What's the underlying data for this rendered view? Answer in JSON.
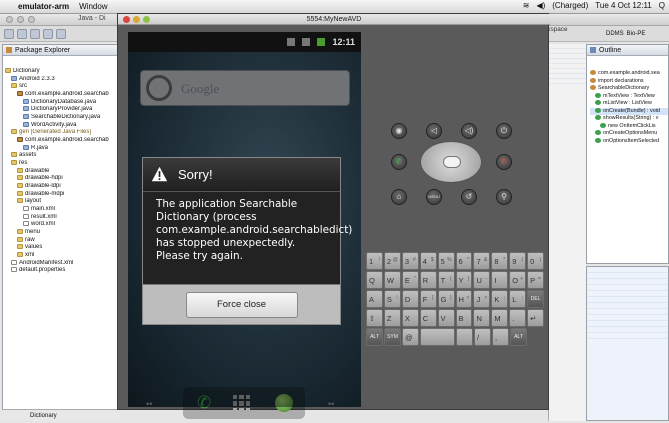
{
  "menubar": {
    "app_name": "emulator-arm",
    "menus": [
      "Window"
    ],
    "status": {
      "charge": "(Charged)",
      "clock": "Tue 4 Oct  12:11"
    }
  },
  "eclipse": {
    "window_title": "Java - Di",
    "workspace_path": "x/workspace",
    "perspectives": [
      "DDMS",
      "Bio-PE"
    ],
    "package_explorer": {
      "title": "Package Explorer",
      "tree": [
        {
          "label": "Dictionary",
          "indent": 0,
          "icon": "project"
        },
        {
          "label": "Android 2.3.3",
          "indent": 1,
          "icon": "library"
        },
        {
          "label": "src",
          "indent": 1,
          "icon": "folder"
        },
        {
          "label": "com.example.android.searchab",
          "indent": 2,
          "icon": "package"
        },
        {
          "label": "DictionaryDatabase.java",
          "indent": 3,
          "icon": "java"
        },
        {
          "label": "DictionaryProvider.java",
          "indent": 3,
          "icon": "java"
        },
        {
          "label": "SearchableDictionary.java",
          "indent": 3,
          "icon": "java"
        },
        {
          "label": "WordActivity.java",
          "indent": 3,
          "icon": "java"
        },
        {
          "label": "gen [Generated Java Files]",
          "indent": 1,
          "icon": "folder",
          "style": "gen"
        },
        {
          "label": "com.example.android.searchab",
          "indent": 2,
          "icon": "package"
        },
        {
          "label": "R.java",
          "indent": 3,
          "icon": "java"
        },
        {
          "label": "assets",
          "indent": 1,
          "icon": "folder"
        },
        {
          "label": "res",
          "indent": 1,
          "icon": "folder"
        },
        {
          "label": "drawable",
          "indent": 2,
          "icon": "folder"
        },
        {
          "label": "drawable-hdpi",
          "indent": 2,
          "icon": "folder"
        },
        {
          "label": "drawable-ldpi",
          "indent": 2,
          "icon": "folder"
        },
        {
          "label": "drawable-mdpi",
          "indent": 2,
          "icon": "folder"
        },
        {
          "label": "layout",
          "indent": 2,
          "icon": "folder"
        },
        {
          "label": "main.xml",
          "indent": 3,
          "icon": "xml"
        },
        {
          "label": "result.xml",
          "indent": 3,
          "icon": "xml"
        },
        {
          "label": "word.xml",
          "indent": 3,
          "icon": "xml"
        },
        {
          "label": "menu",
          "indent": 2,
          "icon": "folder"
        },
        {
          "label": "raw",
          "indent": 2,
          "icon": "folder"
        },
        {
          "label": "values",
          "indent": 2,
          "icon": "folder"
        },
        {
          "label": "xml",
          "indent": 2,
          "icon": "folder"
        },
        {
          "label": "AndroidManifest.xml",
          "indent": 1,
          "icon": "xml"
        },
        {
          "label": "default.properties",
          "indent": 1,
          "icon": "file"
        }
      ]
    },
    "status_bar_text": "Dictionary",
    "outline": {
      "title": "Outline",
      "tree": [
        {
          "label": "com.example.android.sea",
          "indent": 0
        },
        {
          "label": "import declarations",
          "indent": 0
        },
        {
          "label": "SearchableDictionary",
          "indent": 0
        },
        {
          "label": "mTextView : TextView",
          "indent": 1
        },
        {
          "label": "mListView : ListView",
          "indent": 1
        },
        {
          "label": "onCreate(Bundle) : void",
          "indent": 1,
          "selected": true
        },
        {
          "label": "showResults(String) : v",
          "indent": 1
        },
        {
          "label": "new OnItemClickLis",
          "indent": 2
        },
        {
          "label": "onCreateOptionsMenu",
          "indent": 1
        },
        {
          "label": "onOptionsItemSelected",
          "indent": 1
        }
      ]
    }
  },
  "emulator": {
    "title": "5554:MyNewAVD",
    "clock": "12:11",
    "search_placeholder": "Google",
    "dialog": {
      "title": "Sorry!",
      "message": "The application Searchable Dictionary (process com.example.android.searchabledict) has stopped unexpectedly. Please try again.",
      "button": "Force close"
    },
    "keyboard": {
      "row1": [
        [
          "1",
          "!"
        ],
        [
          "2",
          "@"
        ],
        [
          "3",
          "#"
        ],
        [
          "4",
          "$"
        ],
        [
          "5",
          "%"
        ],
        [
          "6",
          "^"
        ],
        [
          "7",
          "&"
        ],
        [
          "8",
          "*"
        ],
        [
          "9",
          "("
        ],
        [
          "0",
          ")"
        ]
      ],
      "row2": [
        [
          "Q",
          ""
        ],
        [
          "W",
          ""
        ],
        [
          "E",
          "\""
        ],
        [
          "R",
          ""
        ],
        [
          "T",
          "{"
        ],
        [
          "Y",
          "}"
        ],
        [
          "U",
          "-"
        ],
        [
          "I",
          ""
        ],
        [
          "O",
          "+"
        ],
        [
          "P",
          "="
        ]
      ],
      "row3": [
        [
          "A",
          ""
        ],
        [
          "S",
          "\\"
        ],
        [
          "D",
          ""
        ],
        [
          "F",
          "["
        ],
        [
          "G",
          "]"
        ],
        [
          "H",
          "<"
        ],
        [
          "J",
          ">"
        ],
        [
          "K",
          ";"
        ],
        [
          "L",
          ":"
        ],
        [
          "DEL",
          ""
        ]
      ],
      "row4": [
        [
          "⇧",
          ""
        ],
        [
          "Z",
          ""
        ],
        [
          "X",
          ""
        ],
        [
          "C",
          ""
        ],
        [
          "V",
          ""
        ],
        [
          "B",
          ""
        ],
        [
          "N",
          ""
        ],
        [
          "M",
          ""
        ],
        [
          ".",
          ""
        ],
        [
          "↵",
          ""
        ]
      ],
      "row5": [
        [
          "ALT",
          ""
        ],
        [
          "SYM",
          ""
        ],
        [
          "@",
          ""
        ],
        [
          "␣",
          ""
        ],
        [
          "",
          ""
        ],
        [
          "/",
          ""
        ],
        [
          ",",
          ""
        ],
        [
          "ALT",
          ""
        ]
      ]
    },
    "buttons": {
      "menu": "MENU"
    }
  }
}
